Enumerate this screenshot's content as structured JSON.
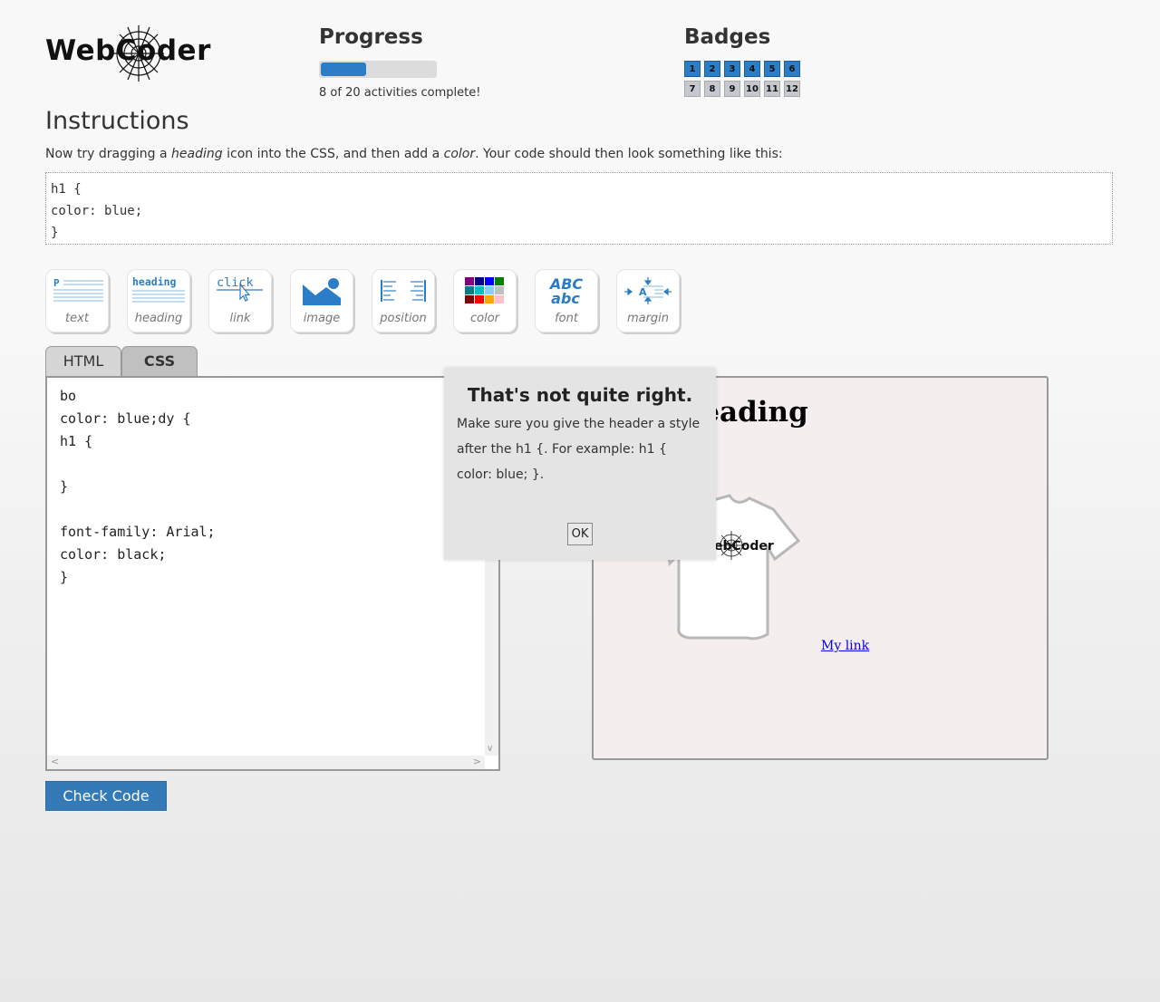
{
  "logo": {
    "text": "WebCoder"
  },
  "progress": {
    "title": "Progress",
    "completed": 8,
    "total": 20,
    "fraction": 0.4,
    "status_text": "8 of 20 activities complete!",
    "bar_color": "#2a7dc6"
  },
  "badges": {
    "title": "Badges",
    "items": [
      {
        "label": "1",
        "earned": true
      },
      {
        "label": "2",
        "earned": true
      },
      {
        "label": "3",
        "earned": true
      },
      {
        "label": "4",
        "earned": true
      },
      {
        "label": "5",
        "earned": true
      },
      {
        "label": "6",
        "earned": true
      },
      {
        "label": "7",
        "earned": false
      },
      {
        "label": "8",
        "earned": false
      },
      {
        "label": "9",
        "earned": false
      },
      {
        "label": "10",
        "earned": false
      },
      {
        "label": "11",
        "earned": false
      },
      {
        "label": "12",
        "earned": false
      }
    ]
  },
  "instructions": {
    "title": "Instructions",
    "text_1": "Now try dragging a ",
    "text_em_1": "heading",
    "text_2": " icon into the CSS, and then add a ",
    "text_em_2": "color",
    "text_3": ". Your code should then look something like this:",
    "example_code": "h1 {\ncolor: blue;\n}"
  },
  "toolbar": {
    "items": [
      {
        "label": "text",
        "icon": "paragraph-lines-icon"
      },
      {
        "label": "heading",
        "icon": "heading-lines-icon",
        "icon_text": "heading"
      },
      {
        "label": "link",
        "icon": "click-cursor-icon",
        "icon_text": "click"
      },
      {
        "label": "image",
        "icon": "landscape-image-icon"
      },
      {
        "label": "position",
        "icon": "align-lines-icon"
      },
      {
        "label": "color",
        "icon": "color-grid-icon"
      },
      {
        "label": "font",
        "icon": "abc-font-icon",
        "icon_text_upper": "ABC",
        "icon_text_lower": "abc"
      },
      {
        "label": "margin",
        "icon": "margin-arrows-icon",
        "icon_text": "A"
      }
    ]
  },
  "tabs": {
    "html": "HTML",
    "css": "CSS",
    "active": "CSS"
  },
  "editor": {
    "lines": [
      "bo",
      "color: blue;dy {",
      "h1 {",
      "",
      "}",
      "",
      "font-family: Arial;",
      "color: black;",
      "}"
    ]
  },
  "preview": {
    "heading": "Heading",
    "shirt_logo_text": "WebCoder",
    "link_text": "My link"
  },
  "check_button": {
    "label": "Check Code"
  },
  "modal": {
    "title": "That's not quite right.",
    "body": "Make sure you give the header a style after the h1 {. For example: h1 { color: blue; }.",
    "ok_label": "OK"
  },
  "colors": {
    "accent": "#337ab7",
    "badge_earned": "#2a7dc6",
    "badge_locked": "#c5c8ce",
    "preview_bg": "#f5eeee",
    "modal_bg": "#e4e4e4"
  }
}
